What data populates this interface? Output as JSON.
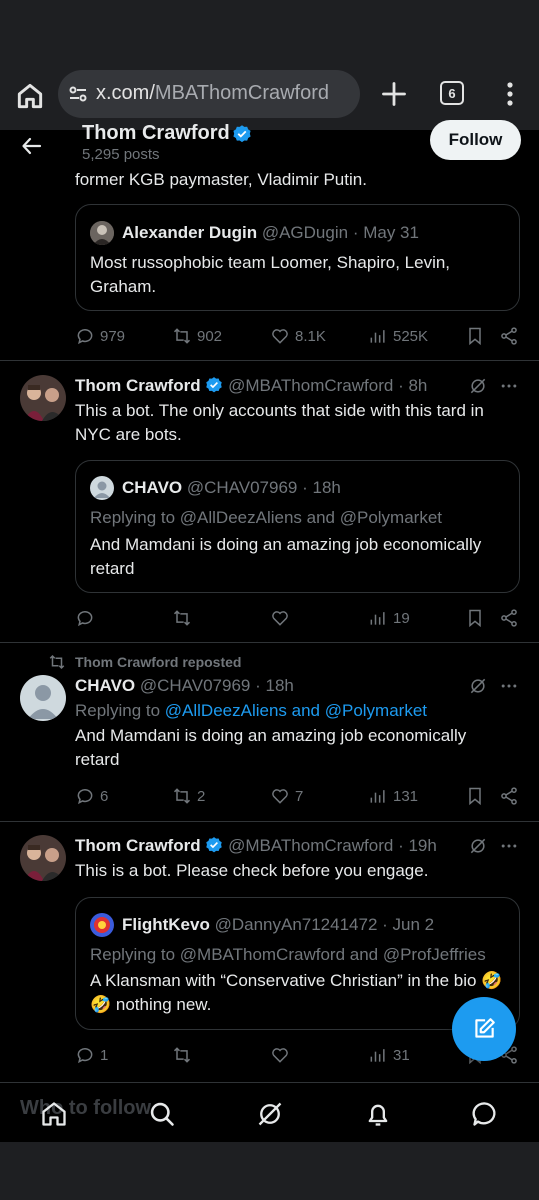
{
  "browser": {
    "url_host": "x.com/",
    "url_path": "MBAThomCrawford",
    "tab_count": "6"
  },
  "profile": {
    "name": "Thom Crawford",
    "posts": "5,295 posts",
    "follow_label": "Follow"
  },
  "tweet1": {
    "text_tail": "former KGB paymaster, Vladimir Putin.",
    "quote": {
      "name": "Alexander Dugin",
      "handle": "@AGDugin",
      "time": "· May 31",
      "text": "Most russophobic team Loomer, Shapiro, Levin, Graham."
    },
    "replies": "979",
    "reposts": "902",
    "likes": "8.1K",
    "views": "525K"
  },
  "tweet2": {
    "name": "Thom Crawford",
    "handle": "@MBAThomCrawford",
    "time": "· 8h",
    "text": "This a bot. The only accounts that side with this tard in NYC are bots.",
    "quote": {
      "name": "CHAVO",
      "handle": "@CHAV07969",
      "time": "· 18h",
      "replying": "Replying to @AllDeezAliens and @Polymarket",
      "text": "And Mamdani is doing an amazing job economically retard"
    },
    "views": "19"
  },
  "tweet3": {
    "repost_label": "Thom Crawford reposted",
    "name": "CHAVO",
    "handle": "@CHAV07969",
    "time": "· 18h",
    "replying_prefix": "Replying to ",
    "replying_targets": "@AllDeezAliens and @Polymarket",
    "text": "And Mamdani is doing an amazing job economically retard",
    "replies": "6",
    "reposts": "2",
    "likes": "7",
    "views": "131"
  },
  "tweet4": {
    "name": "Thom Crawford",
    "handle": "@MBAThomCrawford",
    "time": "· 19h",
    "text": "This is a bot. Please check before you engage.",
    "quote": {
      "name": "FlightKevo",
      "handle": "@DannyAn71241472",
      "time": "· Jun 2",
      "replying": "Replying to @MBAThomCrawford and @ProfJeffries",
      "text_a": "A Klansman with “Conservative Christian” in the bio",
      "emoji": "🤣🤣",
      "text_b": " nothing new."
    },
    "replies": "1",
    "views": "31"
  },
  "bottom": {
    "ghost_text": "Who to follow"
  },
  "colors": {
    "accent": "#1d9bf0",
    "background": "#000000",
    "muted": "#71767b",
    "border": "#2f3336"
  }
}
